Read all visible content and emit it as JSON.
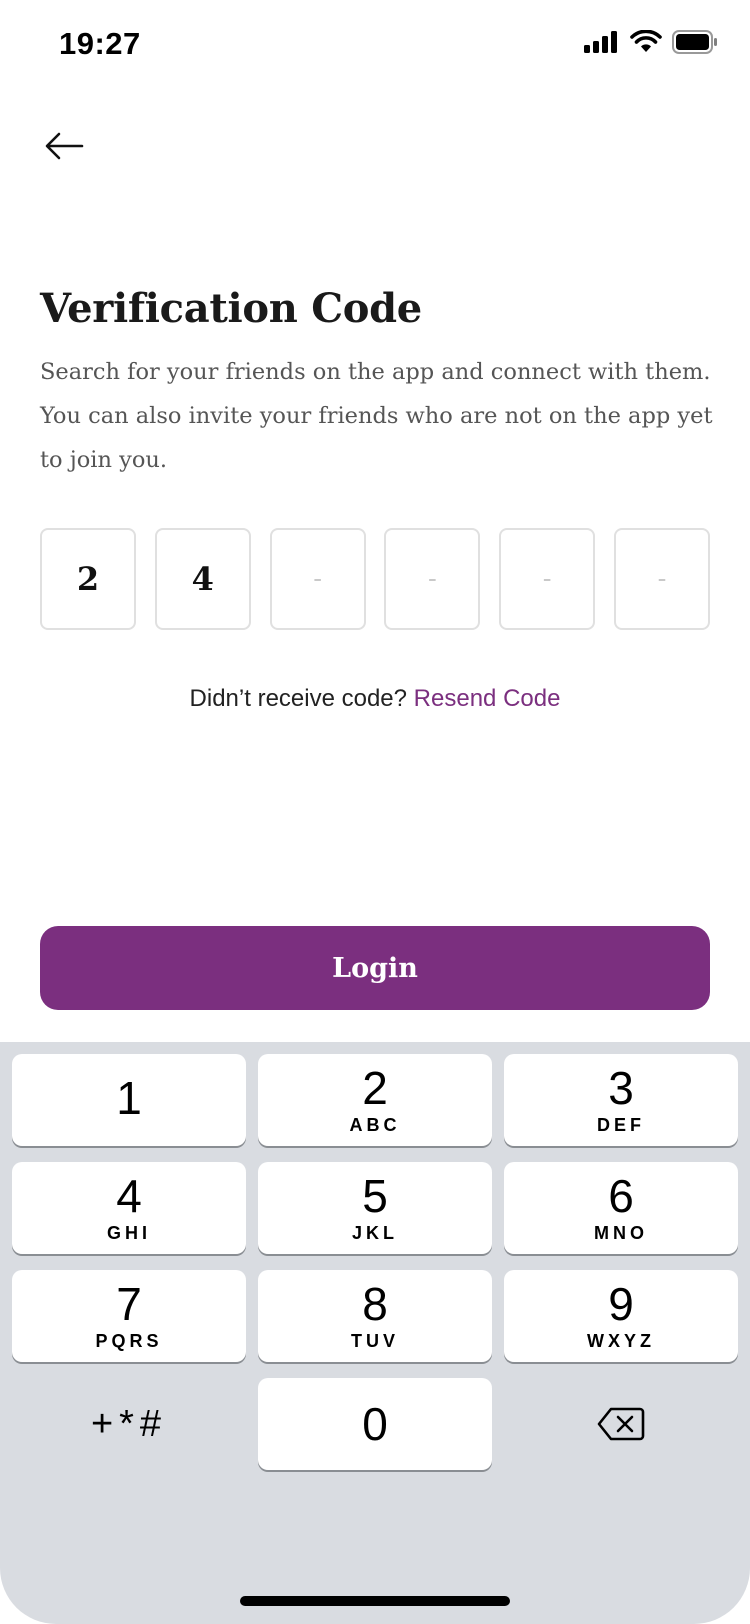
{
  "status_bar": {
    "time": "19:27"
  },
  "header": {
    "back_icon": "arrow-left-icon"
  },
  "main": {
    "title": "Verification Code",
    "subtitle": "Search for your friends on the app and connect with them. You can also invite your friends who are not on the app yet to join you.",
    "code_digits": [
      "2",
      "4",
      "-",
      "-",
      "-",
      "-"
    ],
    "resend_prompt": "Didn’t receive code?",
    "resend_link": "Resend Code",
    "login_label": "Login"
  },
  "colors": {
    "accent": "#7b2f7f",
    "keyboard_bg": "#d9dce1"
  },
  "keyboard": {
    "keys": [
      {
        "num": "1",
        "letters": ""
      },
      {
        "num": "2",
        "letters": "ABC"
      },
      {
        "num": "3",
        "letters": "DEF"
      },
      {
        "num": "4",
        "letters": "GHI"
      },
      {
        "num": "5",
        "letters": "JKL"
      },
      {
        "num": "6",
        "letters": "MNO"
      },
      {
        "num": "7",
        "letters": "PQRS"
      },
      {
        "num": "8",
        "letters": "TUV"
      },
      {
        "num": "9",
        "letters": "WXYZ"
      },
      {
        "num": "0",
        "letters": ""
      }
    ],
    "symbols_label": "+*#",
    "delete_icon": "backspace-icon"
  }
}
